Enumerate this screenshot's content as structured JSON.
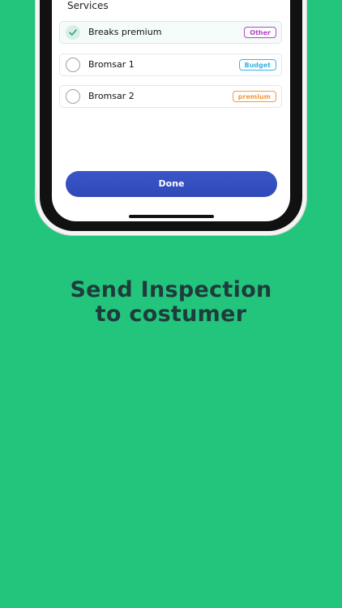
{
  "services": {
    "title": "Services",
    "items": [
      {
        "name": "Breaks premium",
        "tag": "Other",
        "tag_color": "#b245c9",
        "selected": true
      },
      {
        "name": "Bromsar 1",
        "tag": "Budget",
        "tag_color": "#39b4e4",
        "selected": false
      },
      {
        "name": "Bromsar 2",
        "tag": "premium",
        "tag_color": "#f39a3c",
        "selected": false
      }
    ]
  },
  "done_label": "Done",
  "headline": {
    "line1": "Send Inspection",
    "line2": "to costumer"
  },
  "colors": {
    "background": "#23c57c",
    "button": "#3551c2",
    "headline": "#1f3b3c"
  }
}
